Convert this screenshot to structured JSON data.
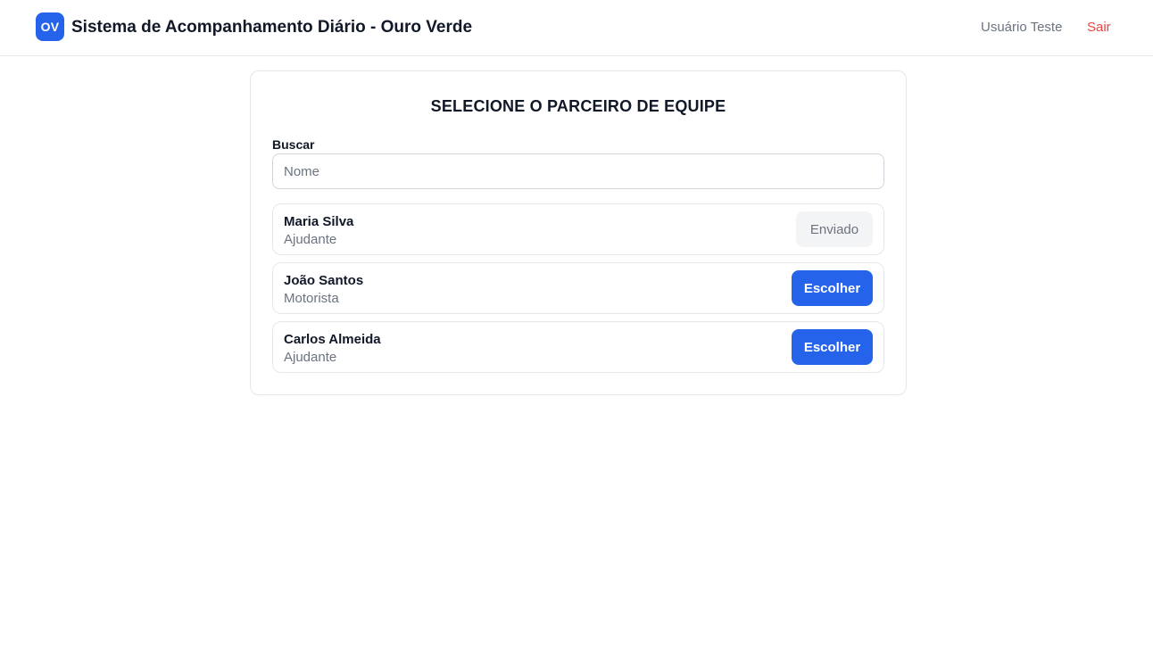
{
  "header": {
    "logo_text": "OV",
    "app_title": "Sistema de Acompanhamento Diário - Ouro Verde",
    "user_name": "Usuário Teste",
    "logout_label": "Sair"
  },
  "card": {
    "title": "SELECIONE O PARCEIRO DE EQUIPE",
    "search": {
      "label": "Buscar",
      "placeholder": "Nome",
      "value": ""
    },
    "partners": [
      {
        "name": "Maria Silva",
        "role": "Ajudante",
        "action_label": "Enviado",
        "action_state": "disabled"
      },
      {
        "name": "João Santos",
        "role": "Motorista",
        "action_label": "Escolher",
        "action_state": "enabled"
      },
      {
        "name": "Carlos Almeida",
        "role": "Ajudante",
        "action_label": "Escolher",
        "action_state": "enabled"
      }
    ]
  },
  "colors": {
    "accent": "#2563eb",
    "danger": "#ef4444",
    "muted_text": "#6b7280",
    "border": "#e5e7eb",
    "disabled_bg": "#f3f4f6"
  }
}
